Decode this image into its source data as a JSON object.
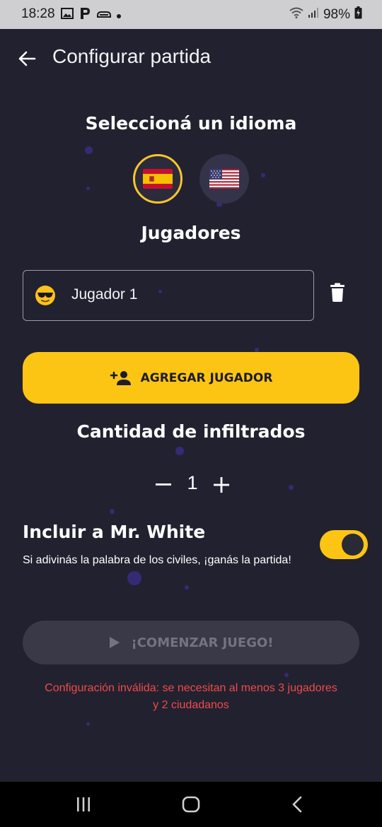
{
  "status_bar": {
    "time": "18:28",
    "battery": "98%",
    "icons": [
      "image-icon",
      "parking-icon",
      "car-icon",
      "dot-icon",
      "wifi-icon",
      "signal-icon",
      "battery-charging-icon"
    ]
  },
  "app_bar": {
    "title": "Configurar partida",
    "back_icon": "arrow-back-icon"
  },
  "language_section": {
    "title": "Seleccioná un idioma",
    "options": [
      {
        "flag": "spain-flag-icon",
        "selected": true
      },
      {
        "flag": "usa-flag-icon",
        "selected": false
      }
    ]
  },
  "players_section": {
    "title": "Jugadores",
    "players": [
      {
        "emoji": "sunglasses-emoji-icon",
        "name": "Jugador 1"
      }
    ],
    "delete_icon": "trash-icon",
    "add_button": {
      "icon": "person-add-icon",
      "label": "AGREGAR JUGADOR"
    }
  },
  "infiltrators_section": {
    "title": "Cantidad de infiltrados",
    "value": "1",
    "minus_icon": "minus-icon",
    "plus_icon": "plus-icon"
  },
  "mr_white": {
    "title": "Incluir a Mr. White",
    "subtitle": "Si adivinás la palabra de los civiles, ¡ganás la partida!",
    "enabled": true
  },
  "start_button": {
    "icon": "play-icon",
    "label": "¡COMENZAR JUEGO!",
    "enabled": false
  },
  "error_message": {
    "line1": "Configuración inválida: se necesitan al menos 3 jugadores",
    "line2": "y 2 ciudadanos"
  },
  "nav_bar": {
    "buttons": [
      "recents-icon",
      "home-icon",
      "back-icon"
    ]
  },
  "colors": {
    "background": "#22212f",
    "accent": "#fdc513",
    "error": "#ee4b4b",
    "disabled_button": "#3a3947"
  }
}
